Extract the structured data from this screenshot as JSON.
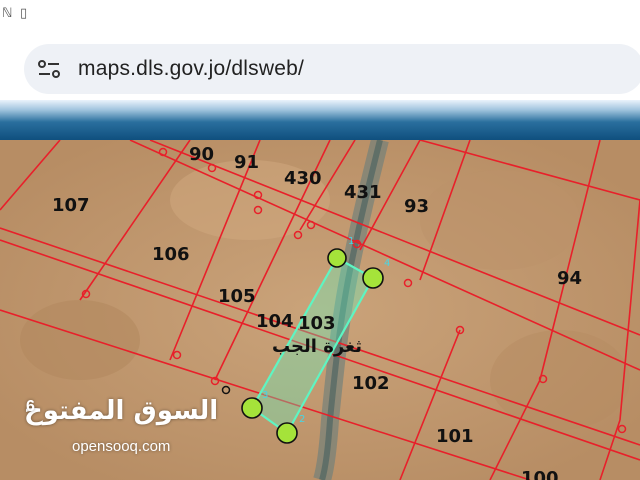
{
  "status_bar": {
    "icons": [
      "n-icon",
      "vibrate-icon"
    ]
  },
  "browser": {
    "url": "maps.dls.gov.jo/dlsweb/",
    "url_icon": "site-settings-icon"
  },
  "map": {
    "parcels": [
      {
        "id": "p90",
        "label": "90"
      },
      {
        "id": "p91",
        "label": "91"
      },
      {
        "id": "p430",
        "label": "430"
      },
      {
        "id": "p431",
        "label": "431"
      },
      {
        "id": "p93",
        "label": "93"
      },
      {
        "id": "p107",
        "label": "107"
      },
      {
        "id": "p106",
        "label": "106"
      },
      {
        "id": "p94",
        "label": "94"
      },
      {
        "id": "p105",
        "label": "105"
      },
      {
        "id": "p104",
        "label": "104"
      },
      {
        "id": "p103",
        "label": "103"
      },
      {
        "id": "p102",
        "label": "102"
      },
      {
        "id": "p101",
        "label": "101"
      },
      {
        "id": "p100",
        "label": "100"
      }
    ],
    "area_name": "ثغرة الجب",
    "selection_color": "#5ef5c2",
    "boundary_color": "#e8202a",
    "vertex_color": "#a5e33a"
  },
  "watermark": {
    "arabic": "السوق المفتوح",
    "number": "6",
    "english": "opensooq.com"
  }
}
